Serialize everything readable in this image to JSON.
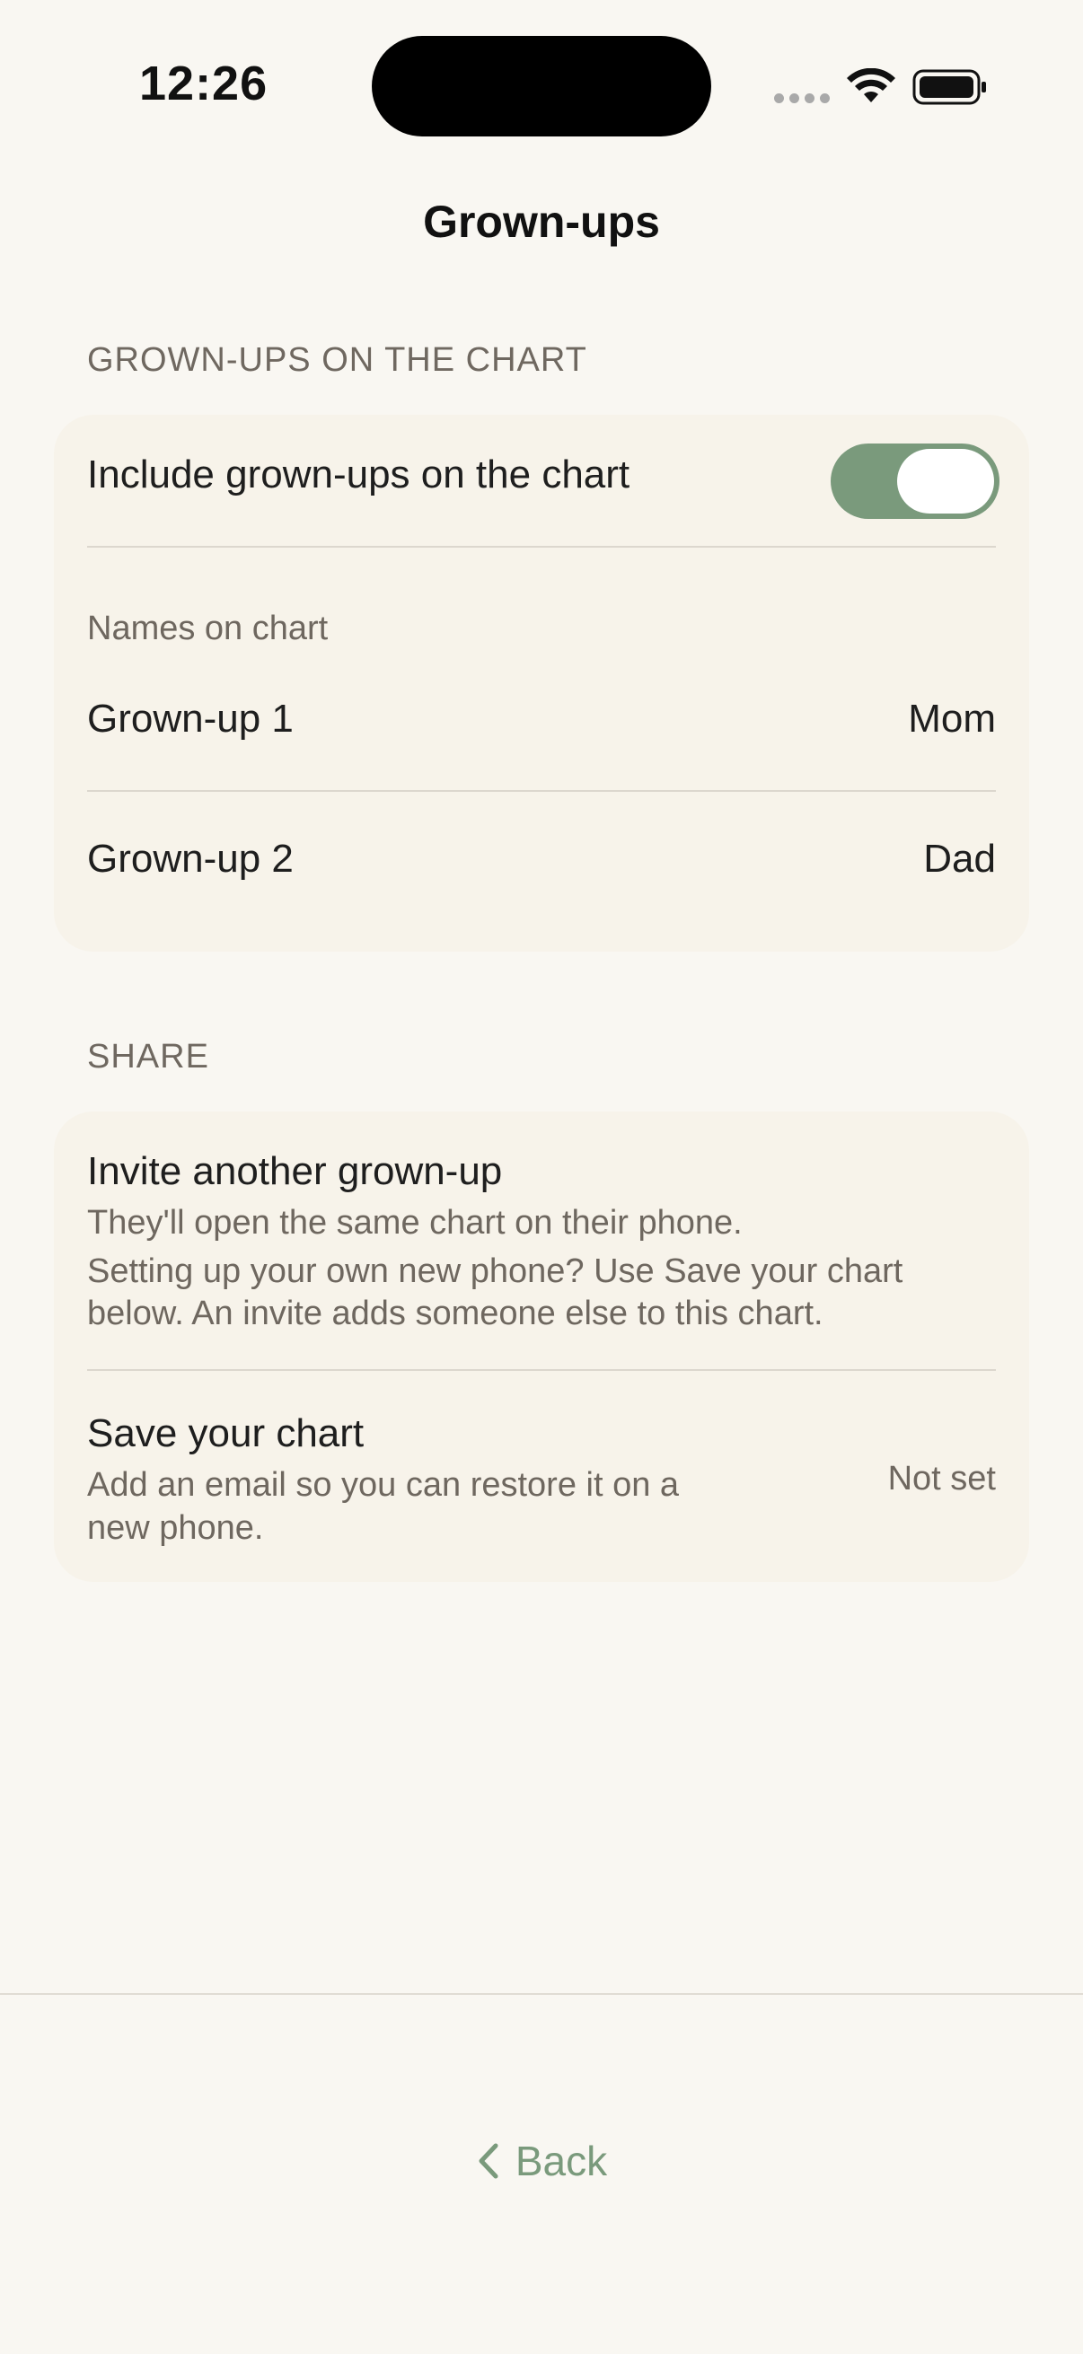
{
  "status_bar": {
    "time": "12:26"
  },
  "header": {
    "title": "Grown-ups"
  },
  "grownups_section": {
    "header": "GROWN-UPS ON THE CHART",
    "include_label": "Include grown-ups on the chart",
    "include_on": true,
    "names_label": "Names on chart",
    "rows": [
      {
        "label": "Grown-up 1",
        "value": "Mom"
      },
      {
        "label": "Grown-up 2",
        "value": "Dad"
      }
    ]
  },
  "share_section": {
    "header": "SHARE",
    "invite": {
      "title": "Invite another grown-up",
      "line1": "They'll open the same chart on their phone.",
      "line2a": "Setting up your own new phone? Use Save your chart",
      "line2b": "below. An invite adds someone else to this chart."
    },
    "save": {
      "title": "Save your chart",
      "line1": "Add an email so you can restore it on a",
      "line2": "new phone.",
      "value": "Not set"
    }
  },
  "footer": {
    "back_label": "Back"
  },
  "colors": {
    "accent": "#7a9a7c",
    "background": "#f9f7f2",
    "card": "#f7f3ea"
  },
  "icons": {
    "wifi": "wifi-icon",
    "battery": "battery-icon",
    "back": "chevron-left-icon"
  }
}
